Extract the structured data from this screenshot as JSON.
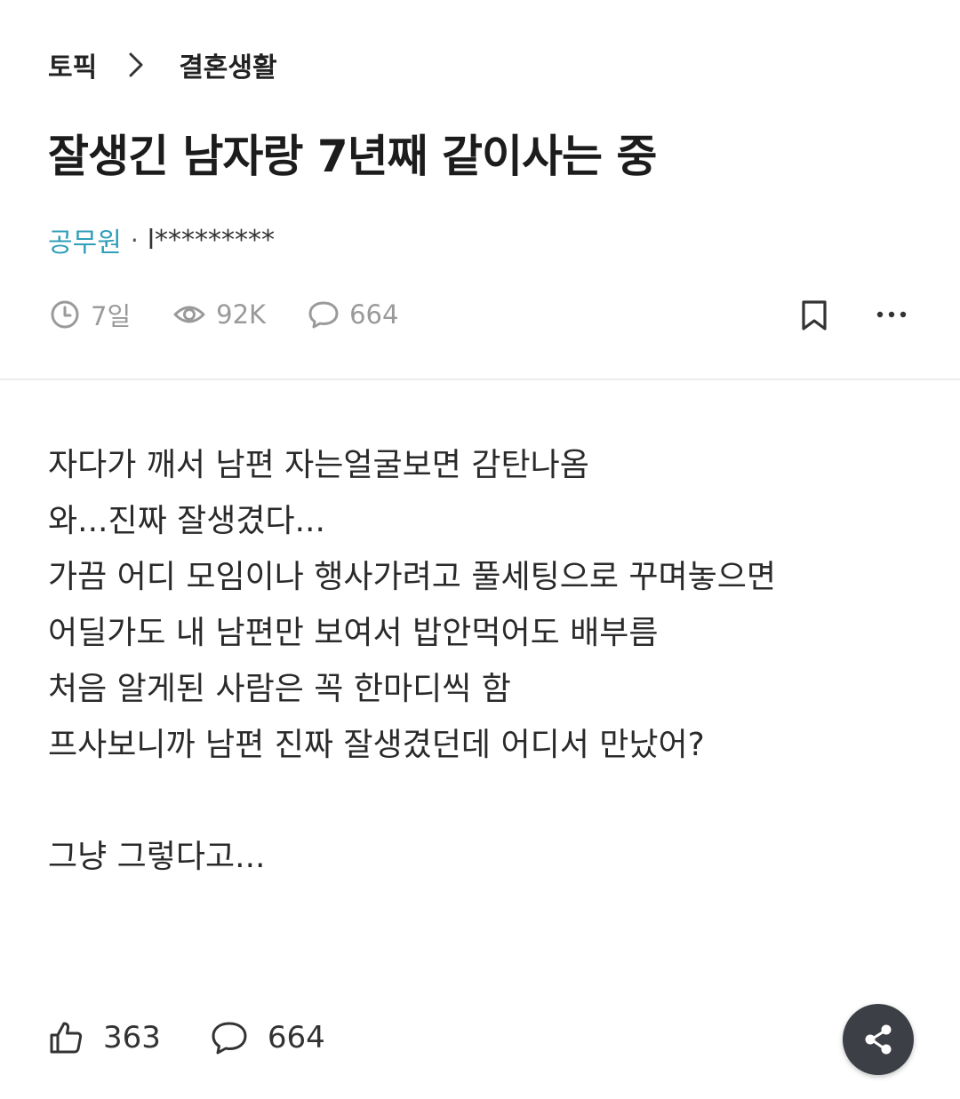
{
  "breadcrumb": {
    "root": "토픽",
    "current": "결혼생활"
  },
  "post": {
    "title": "잘생긴 남자랑 7년째 같이사는 중",
    "company": "공무원",
    "separator": "·",
    "nickname": "l*********",
    "time": "7일",
    "views": "92K",
    "comments": "664",
    "body": [
      "자다가 깨서 남편 자는얼굴보면 감탄나옴",
      "와...진짜 잘생겼다...",
      "가끔 어디 모임이나 행사가려고 풀세팅으로 꾸며놓으면",
      "어딜가도 내 남편만 보여서 밥안먹어도 배부름",
      "처음 알게된 사람은 꼭 한마디씩 함",
      "프사보니까 남편 진짜 잘생겼던데 어디서 만났어?",
      "",
      "그냥 그렇다고..."
    ]
  },
  "footer": {
    "likes": "363",
    "comments": "664"
  },
  "icons": [
    "chevron-right-icon",
    "clock-icon",
    "eye-icon",
    "comment-icon",
    "bookmark-icon",
    "more-icon",
    "thumbs-up-icon",
    "share-icon"
  ],
  "colors": {
    "accent": "#2f9fba",
    "meta": "#9a9a9a",
    "share_bg": "#3c3f45"
  }
}
